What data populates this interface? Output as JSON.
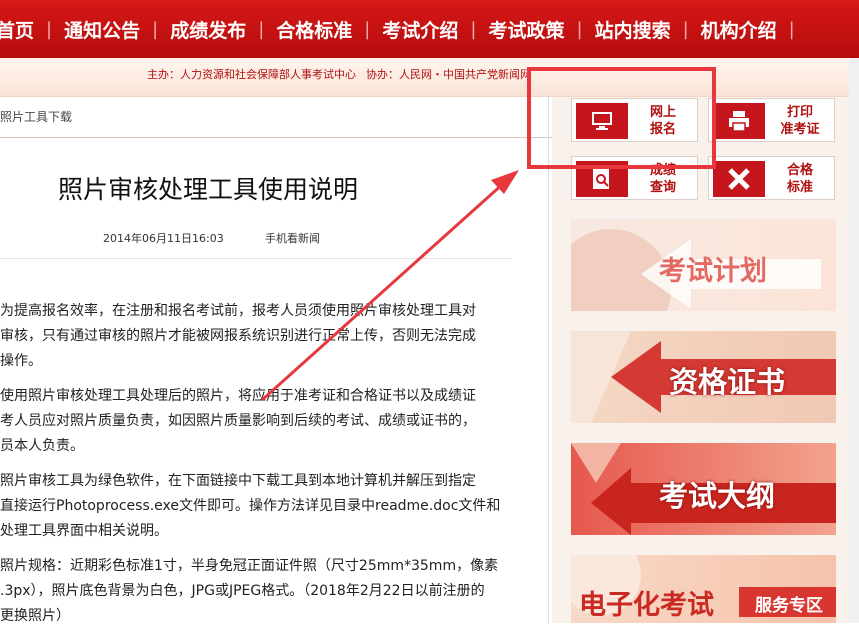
{
  "nav": {
    "items": [
      "首页",
      "通知公告",
      "成绩发布",
      "合格标准",
      "考试介绍",
      "考试政策",
      "站内搜索",
      "机构介绍"
    ],
    "separator": "|"
  },
  "sponsor": {
    "host": "主办：人力资源和社会保障部人事考试中心",
    "co": "协办：人民网・中国共产党新闻网"
  },
  "breadcrumb": "照片工具下载",
  "article": {
    "title": "照片审核处理工具使用说明",
    "date": "2014年06月11日16:03",
    "mobile_link": "手机看新闻",
    "paragraphs": [
      [
        "为提高报名效率，在注册和报名考试前，报考人员须使用照片审核处理工具对",
        "审核，只有通过审核的照片才能被网报系统识别进行正常上传，否则无法完成",
        "操作。"
      ],
      [
        "使用照片审核处理工具处理后的照片，将应用于准考证和合格证书以及成绩证",
        "考人员应对照片质量负责，如因照片质量影响到后续的考试、成绩或证书的，",
        "员本人负责。"
      ],
      [
        "照片审核工具为绿色软件，在下面链接中下载工具到本地计算机并解压到指定",
        "直接运行Photoprocess.exe文件即可。操作方法详见目录中readme.doc文件和",
        "处理工具界面中相关说明。"
      ],
      [
        "照片规格：近期彩色标准1寸，半身免冠正面证件照（尺寸25mm*35mm，像素",
        ".3px），照片底色背景为白色，JPG或JPEG格式。（2018年2月22日以前注册的",
        "更换照片）"
      ]
    ]
  },
  "quick_links": [
    {
      "label1": "网上",
      "label2": "报名",
      "icon": "monitor-icon"
    },
    {
      "label1": "打印",
      "label2": "准考证",
      "icon": "printer-icon"
    },
    {
      "label1": "成绩",
      "label2": "查询",
      "icon": "magnifier-icon"
    },
    {
      "label1": "合格",
      "label2": "标准",
      "icon": "pencil-ruler-icon"
    }
  ],
  "banners": [
    {
      "text": "考试计划"
    },
    {
      "text": "资格证书"
    },
    {
      "text": "考试大纲"
    },
    {
      "text": "电子化考试",
      "sub": "服务专区"
    }
  ],
  "colors": {
    "brand_red": "#c4161c",
    "annotation_red": "#e8383d"
  }
}
